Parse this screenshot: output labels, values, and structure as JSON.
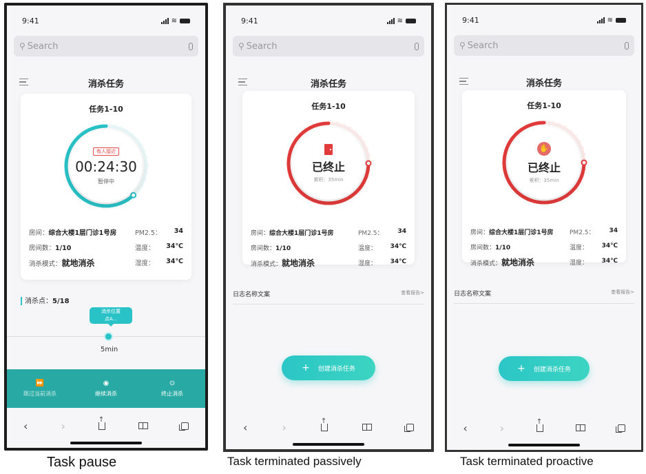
{
  "common": {
    "time": "9:41",
    "search_placeholder": "Search",
    "app_title": "消杀任务",
    "task_title": "任务1-10",
    "room_label": "房间：",
    "room_value": "综合大楼1层门诊1号房",
    "pm_label": "PM2.5：",
    "pm_value": "34",
    "room_count_label": "房间数：",
    "room_count_value": "1/10",
    "temp_label": "温度：",
    "temp_value": "34℃",
    "mode_label": "消杀模式：",
    "mode_value": "就地消杀",
    "humidity_label": "湿度：",
    "humidity_value": "34℃",
    "accent_color": "#29c2c7",
    "stop_color": "#e23b3b"
  },
  "phone1": {
    "badge": "有人接近",
    "timer": "00:24:30",
    "state": "暂停中",
    "progress": 0.62,
    "points_label": "消杀点：",
    "points_value": "5/18",
    "bubble_line1": "消杀位置",
    "bubble_line2": "点A...",
    "timeline_label": "5min",
    "actions": [
      {
        "icon": "skip-icon",
        "label": "跳过当前消杀"
      },
      {
        "icon": "play-icon",
        "label": "继续消杀"
      },
      {
        "icon": "stop-icon",
        "label": "终止消杀"
      }
    ]
  },
  "phone2": {
    "state": "已终止",
    "duration": "累积：35min",
    "progress": 0.75,
    "log_title": "日志名称文案",
    "log_link": "查看报告>",
    "create_label": "创建消杀任务"
  },
  "phone3": {
    "state": "已终止",
    "duration": "累积：35min",
    "progress": 0.75,
    "log_title": "日志名称文案",
    "log_link": "查看报告>",
    "create_label": "创建消杀任务"
  },
  "captions": {
    "c1": "Task pause",
    "c2": "Task terminated passively",
    "c3": "Task terminated proactive"
  }
}
